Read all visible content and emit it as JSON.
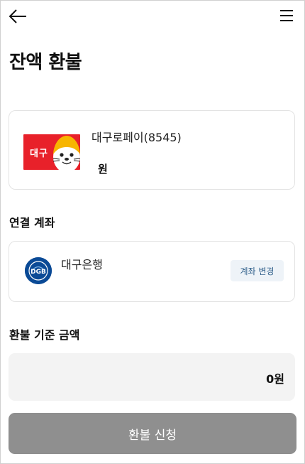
{
  "header": {
    "title": "잔액 환불",
    "back_icon": "arrow-left-icon",
    "menu_icon": "hamburger-menu-icon"
  },
  "pay": {
    "logo_text": "대구",
    "name": "대구로페이(8545)",
    "balance": "원",
    "brand_color": "#e8212a"
  },
  "account": {
    "section_label": "연결 계좌",
    "bank_name": "대구은행",
    "bank_logo_text": "DGB",
    "change_label": "계좌 변경",
    "bank_color": "#0a4a96"
  },
  "amount": {
    "section_label": "환불 기준 금액",
    "value": "0원"
  },
  "submit": {
    "label": "환불 신청",
    "disabled_color": "#8f8f8f"
  }
}
